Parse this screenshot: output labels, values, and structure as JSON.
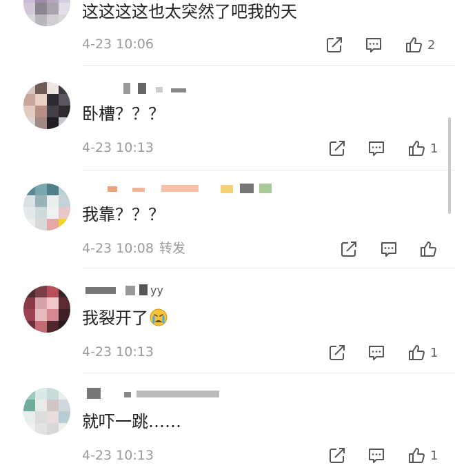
{
  "comments": [
    {
      "text": "这这这这也太突然了吧我的天",
      "time": "4-23 10:06",
      "likes": "2"
    },
    {
      "text": "卧槽？？？",
      "time": "4-23 10:13",
      "likes": "1"
    },
    {
      "text": "我靠？？？",
      "time": "4-23 10:08",
      "forward_label": "转发",
      "likes": ""
    },
    {
      "username_fragment": "yy",
      "text": "我裂开了",
      "emoji": "crying-face-emoji",
      "time": "4-23 10:13",
      "likes": "1"
    },
    {
      "text": "就吓一跳……",
      "time": "4-23 10:13",
      "likes": "1"
    }
  ],
  "icons": {
    "share": "share-icon",
    "comment": "comment-icon",
    "like": "thumbs-up-icon"
  },
  "colors": {
    "text": "#222222",
    "meta": "#9a9a9a",
    "icon": "#555555",
    "divider": "#e8e8e8"
  }
}
